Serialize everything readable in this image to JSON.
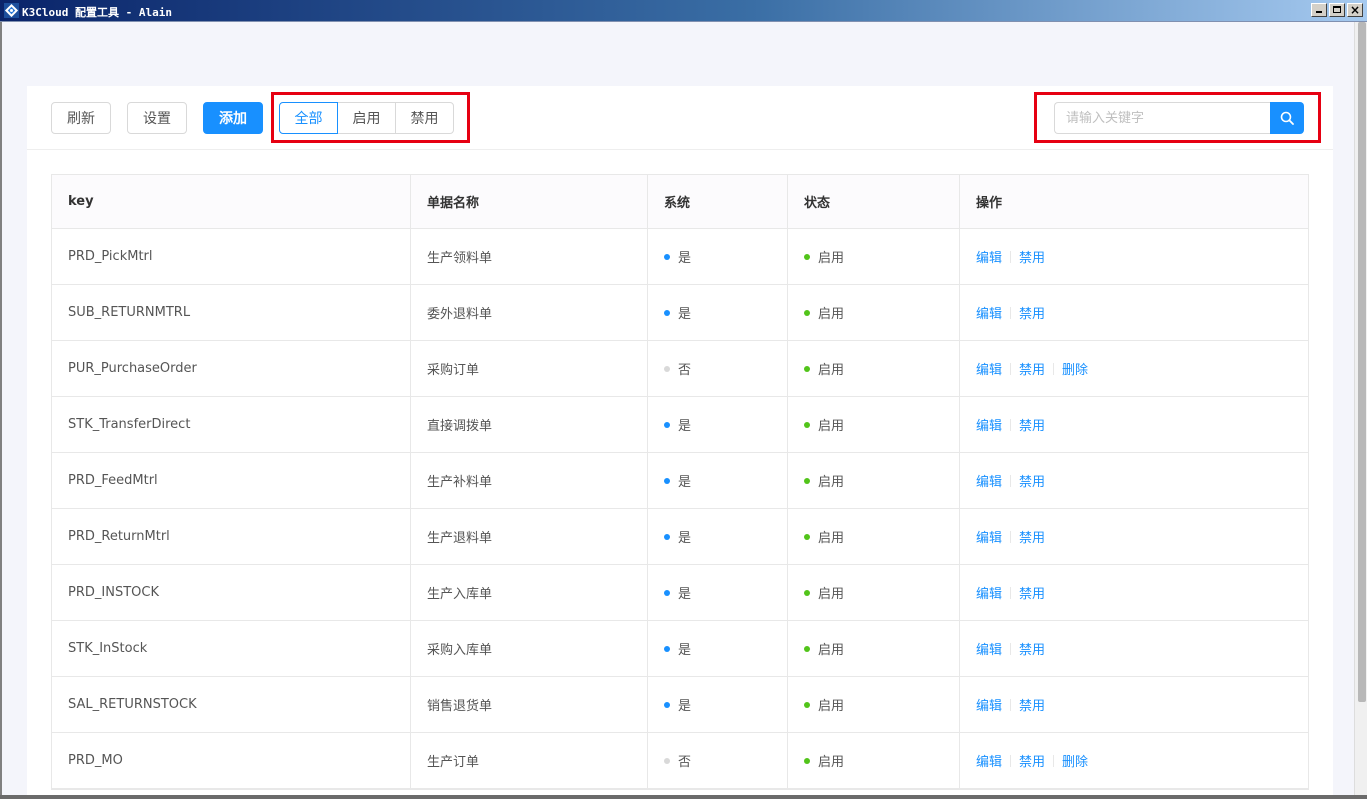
{
  "window": {
    "title": "K3Cloud 配置工具 - Alain"
  },
  "toolbar": {
    "refresh_label": "刷新",
    "settings_label": "设置",
    "add_label": "添加",
    "filters": [
      {
        "label": "全部",
        "active": true
      },
      {
        "label": "启用",
        "active": false
      },
      {
        "label": "禁用",
        "active": false
      }
    ],
    "search_placeholder": "请输入关键字",
    "search_value": ""
  },
  "table": {
    "columns": [
      "key",
      "单据名称",
      "系统",
      "状态",
      "操作"
    ],
    "rows": [
      {
        "key": "PRD_PickMtrl",
        "name": "生产领料单",
        "system": "是",
        "status": "启用",
        "actions": [
          "编辑",
          "禁用"
        ]
      },
      {
        "key": "SUB_RETURNMTRL",
        "name": "委外退料单",
        "system": "是",
        "status": "启用",
        "actions": [
          "编辑",
          "禁用"
        ]
      },
      {
        "key": "PUR_PurchaseOrder",
        "name": "采购订单",
        "system": "否",
        "status": "启用",
        "actions": [
          "编辑",
          "禁用",
          "删除"
        ]
      },
      {
        "key": "STK_TransferDirect",
        "name": "直接调拨单",
        "system": "是",
        "status": "启用",
        "actions": [
          "编辑",
          "禁用"
        ]
      },
      {
        "key": "PRD_FeedMtrl",
        "name": "生产补料单",
        "system": "是",
        "status": "启用",
        "actions": [
          "编辑",
          "禁用"
        ]
      },
      {
        "key": "PRD_ReturnMtrl",
        "name": "生产退料单",
        "system": "是",
        "status": "启用",
        "actions": [
          "编辑",
          "禁用"
        ]
      },
      {
        "key": "PRD_INSTOCK",
        "name": "生产入库单",
        "system": "是",
        "status": "启用",
        "actions": [
          "编辑",
          "禁用"
        ]
      },
      {
        "key": "STK_InStock",
        "name": "采购入库单",
        "system": "是",
        "status": "启用",
        "actions": [
          "编辑",
          "禁用"
        ]
      },
      {
        "key": "SAL_RETURNSTOCK",
        "name": "销售退货单",
        "system": "是",
        "status": "启用",
        "actions": [
          "编辑",
          "禁用"
        ]
      },
      {
        "key": "PRD_MO",
        "name": "生产订单",
        "system": "否",
        "status": "启用",
        "actions": [
          "编辑",
          "禁用",
          "删除"
        ]
      }
    ]
  },
  "colors": {
    "primary": "#1890ff",
    "system_yes_dot": "#1890ff",
    "system_no_dot": "#d9d9d9",
    "status_enabled_dot": "#52c41a",
    "highlight_box": "#e60012"
  },
  "icons": {
    "app": "k3cloud-logo-icon",
    "search": "search-icon"
  }
}
